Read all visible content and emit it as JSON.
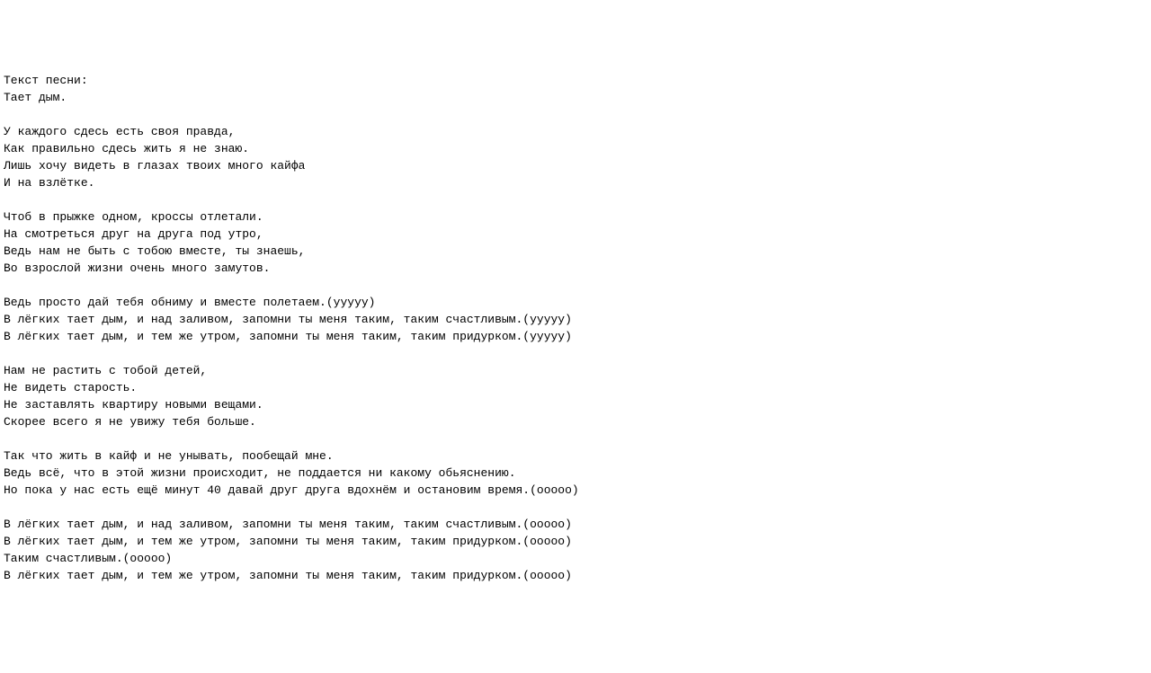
{
  "doc": {
    "header_label": "Текст песни:",
    "title": "Тает дым.",
    "stanzas": [
      [
        "У каждого сдесь есть своя правда,",
        "Как правильно сдесь жить я не знаю.",
        "Лишь хочу видеть в глазах твоих много кайфа",
        "И на взлётке."
      ],
      [
        "Чтоб в прыжке одном, кроссы отлетали.",
        "На смотреться друг на друга под утро,",
        "Ведь нам не быть с тобою вместе, ты знаешь,",
        "Во взрослой жизни очень много замутов."
      ],
      [
        "Ведь просто дай тебя обниму и вместе полетаем.(ууууу)",
        "В лёгких тает дым, и над заливом, запомни ты меня таким, таким счастливым.(ууууу)",
        "В лёгких тает дым, и тем же утром, запомни ты меня таким, таким придурком.(ууууу)"
      ],
      [
        "Нам не растить с тобой детей,",
        "Не видеть старость.",
        "Не заставлять квартиру новыми вещами.",
        "Скорее всего я не увижу тебя больше."
      ],
      [
        "Так что жить в кайф и не унывать, пообещай мне.",
        "Ведь всё, что в этой жизни происходит, не поддается ни какому обьяснению.",
        "Но пока у нас есть ещё минут 40 давай друг друга вдохнём и остановим время.(ооооо)"
      ],
      [
        "В лёгких тает дым, и над заливом, запомни ты меня таким, таким счастливым.(ооооо)",
        "В лёгких тает дым, и тем же утром, запомни ты меня таким, таким придурком.(ооооо)",
        "Таким счастливым.(ооооо)",
        "В лёгких тает дым, и тем же утром, запомни ты меня таким, таким придурком.(ооооо)"
      ]
    ]
  }
}
